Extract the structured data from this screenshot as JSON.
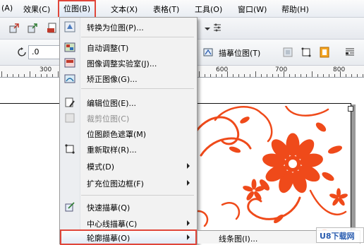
{
  "menubar": {
    "items": [
      {
        "label": "(A)"
      },
      {
        "label": "效果(C)"
      },
      {
        "label": "位图(B)"
      },
      {
        "label": "文本(X)"
      },
      {
        "label": "表格(T)"
      },
      {
        "label": "工具(O)"
      },
      {
        "label": "窗口(W)"
      },
      {
        "label": "帮助(H)"
      }
    ]
  },
  "toolbar": {
    "rotation_value": ".0",
    "trace_button_label": "描摹位图(T)"
  },
  "ruler": {
    "labels": [
      "300",
      "600",
      "700",
      "800"
    ]
  },
  "bitmap_menu": {
    "items": [
      {
        "label": "转换为位图(P)..."
      },
      {
        "label": "自动调整(T)"
      },
      {
        "label": "图像调整实验室(J)..."
      },
      {
        "label": "矫正图像(G)..."
      },
      {
        "label": "编辑位图(E)..."
      },
      {
        "label": "裁剪位图(C)"
      },
      {
        "label": "位图颜色遮罩(M)"
      },
      {
        "label": "重新取样(R)..."
      },
      {
        "label": "模式(D)"
      },
      {
        "label": "扩充位图边框(F)"
      },
      {
        "label": "快速描摹(Q)"
      },
      {
        "label": "中心线描摹(C)"
      },
      {
        "label": "轮廓描摹(O)"
      }
    ]
  },
  "submenu": {
    "first_item": "线条图(I)..."
  },
  "watermark": {
    "text": "U8下载网"
  },
  "colors": {
    "highlight_border": "#e0463a",
    "artwork": "#ef4a1a"
  }
}
